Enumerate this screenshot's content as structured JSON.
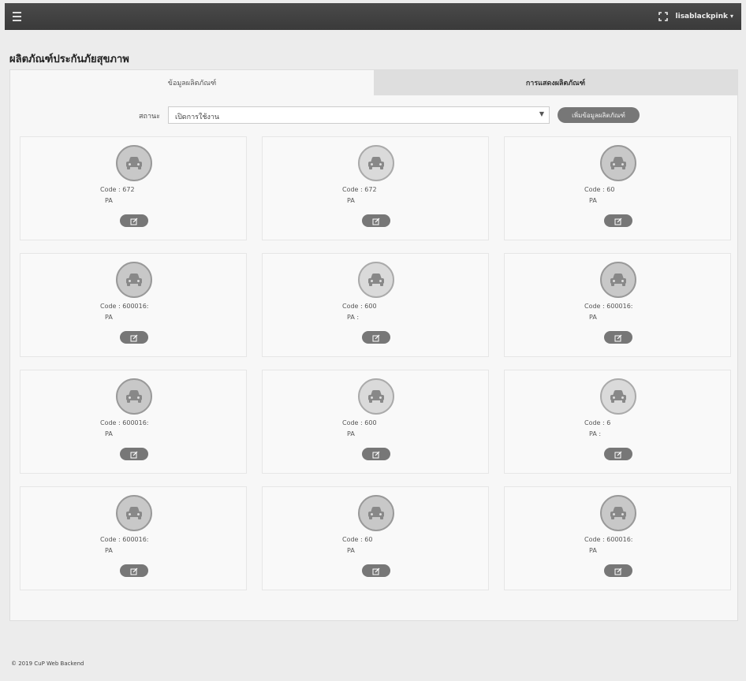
{
  "topbar": {
    "username": "lisablackpink",
    "caret": "▾"
  },
  "page": {
    "title": "ผลิตภัณฑ์ประกันภัยสุขภาพ"
  },
  "tabs": [
    {
      "label": "ข้อมูลผลิตภัณฑ์"
    },
    {
      "label": "การแสดงผลิตภัณฑ์"
    }
  ],
  "filter": {
    "label": "สถานะ",
    "selected": "เปิดการใช้งาน",
    "arrow": "▼"
  },
  "add_button": {
    "label": "เพิ่มข้อมูลผลิตภัณฑ์"
  },
  "products": [
    {
      "code": "Code : 672",
      "pa": "PA"
    },
    {
      "code": "Code : 672",
      "pa": "PA"
    },
    {
      "code": "Code : 60",
      "pa": "PA"
    },
    {
      "code": "Code : 600016:",
      "pa": "PA"
    },
    {
      "code": "Code : 600",
      "pa": "PA :"
    },
    {
      "code": "Code : 600016:",
      "pa": "PA"
    },
    {
      "code": "Code : 600016:",
      "pa": "PA"
    },
    {
      "code": "Code : 600",
      "pa": "PA"
    },
    {
      "code": "Code : 6",
      "pa": "PA :"
    },
    {
      "code": "Code : 600016:",
      "pa": "PA"
    },
    {
      "code": "Code : 60",
      "pa": "PA"
    },
    {
      "code": "Code : 600016:",
      "pa": "PA"
    }
  ],
  "icons": {
    "product": "car-icon",
    "edit": "edit-icon",
    "menu": "hamburger-menu-icon",
    "expand": "fullscreen-icon"
  },
  "footer": {
    "text": "© 2019 CuP Web Backend"
  }
}
